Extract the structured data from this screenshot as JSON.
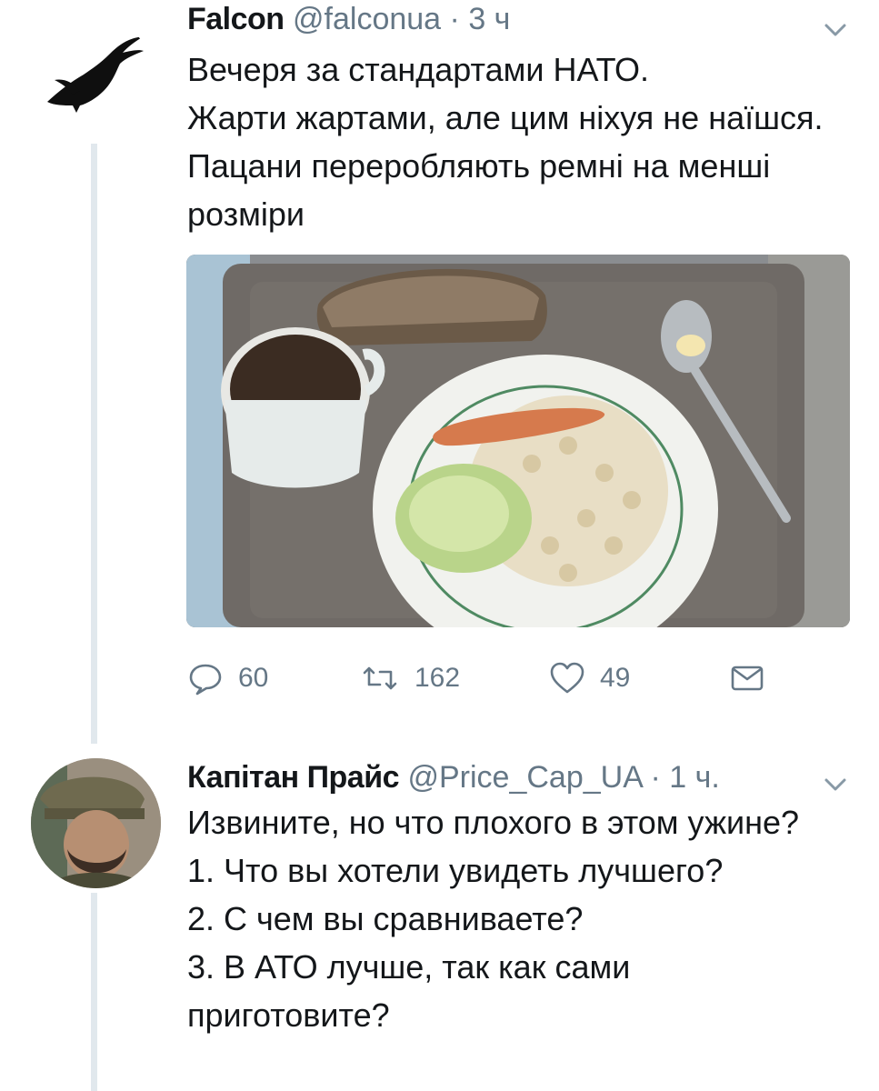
{
  "colors": {
    "thread_line": "#e1e8ed",
    "muted": "#657786",
    "text": "#14171a"
  },
  "tweets": [
    {
      "author_name": "Falcon",
      "handle": "@falconua",
      "separator": "·",
      "time": "3 ч",
      "text": "Вечеря за стандартами НАТО.\nЖарти жартами, але цим ніхуя не наїшся. Пацани переробляють ремні на менші розміри",
      "media_alt": "photo-tray-meal",
      "actions": {
        "reply_count": "60",
        "retweet_count": "162",
        "like_count": "49"
      }
    },
    {
      "author_name": "Капітан Прайс",
      "handle": "@Price_Cap_UA",
      "separator": "·",
      "time": "1 ч.",
      "text": "Извините, но что плохого в этом ужине?\n1. Что вы хотели увидеть лучшего?\n2. С чем вы сравниваете?\n3. В АТО лучше, так как сами приготовите?"
    }
  ],
  "icons": [
    "crow-avatar-icon",
    "chevron-down-icon",
    "reply-icon",
    "retweet-icon",
    "heart-icon",
    "direct-message-icon"
  ]
}
